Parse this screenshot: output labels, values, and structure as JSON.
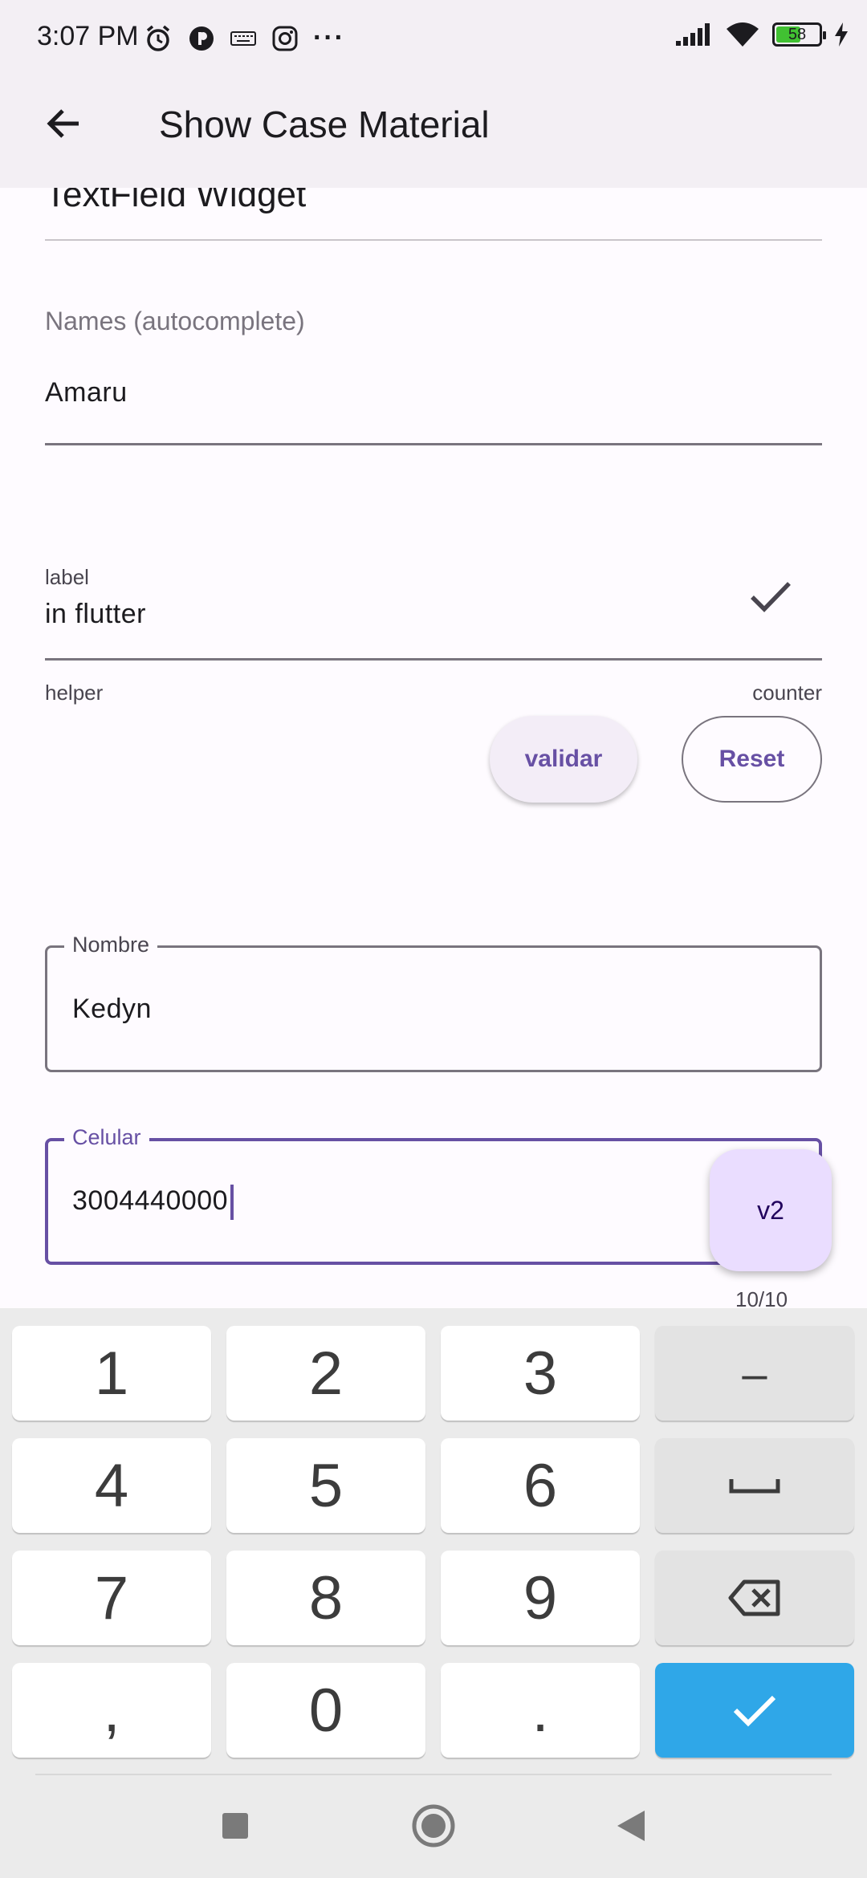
{
  "status_bar": {
    "time": "3:07 PM",
    "battery_level": "58",
    "battery_fraction": 0.58,
    "more_indicator": "···"
  },
  "app_bar": {
    "title": "Show Case Material"
  },
  "section": {
    "heading": "TextField Widget"
  },
  "names_field": {
    "label": "Names (autocomplete)",
    "value": "Amaru"
  },
  "flutter_field": {
    "label": "label",
    "value": "in flutter",
    "helper": "helper",
    "counter": "counter"
  },
  "buttons": {
    "validate": "validar",
    "reset": "Reset"
  },
  "nombre_field": {
    "label": "Nombre",
    "value": "Kedyn"
  },
  "celular_field": {
    "label": "Celular",
    "value": "3004440000",
    "counter": "10/10"
  },
  "fab": {
    "label": "v2"
  },
  "keyboard": {
    "keys": [
      "1",
      "2",
      "3",
      "4",
      "5",
      "6",
      "7",
      "8",
      "9",
      ",",
      "0",
      "."
    ],
    "minus": "–"
  },
  "colors": {
    "primary": "#6750a4",
    "surface": "#fefbff",
    "app_bar": "#f3eff4",
    "keyboard_accent": "#2fa7e8"
  }
}
